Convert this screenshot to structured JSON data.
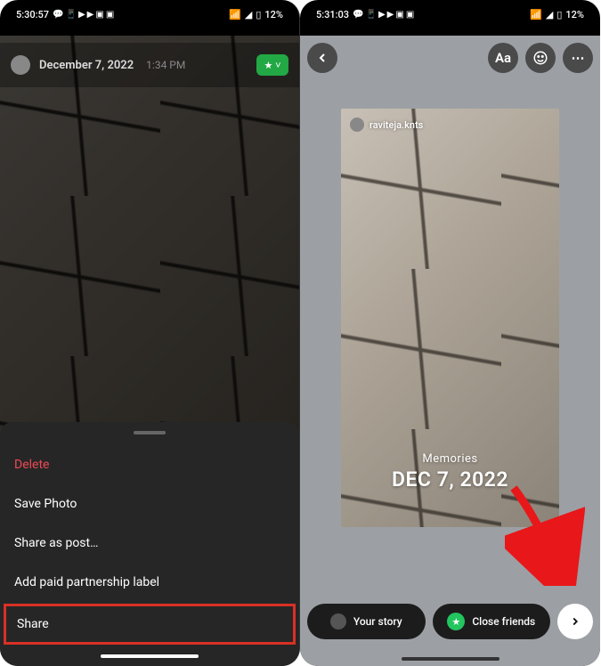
{
  "left": {
    "status": {
      "time": "5:30:57",
      "battery": "12%"
    },
    "photo": {
      "date": "December 7, 2022",
      "time": "1:34 PM"
    },
    "sheet": {
      "delete": "Delete",
      "save": "Save Photo",
      "share_post": "Share as post…",
      "paid": "Add paid partnership label",
      "share": "Share"
    }
  },
  "right": {
    "status": {
      "time": "5:31:03",
      "battery": "12%"
    },
    "toolbar": {
      "text_label": "Aa"
    },
    "story": {
      "username": "raviteja.knts",
      "memories_label": "Memories",
      "memories_date": "DEC 7, 2022"
    },
    "footer": {
      "your_story": "Your story",
      "close_friends": "Close friends"
    }
  }
}
